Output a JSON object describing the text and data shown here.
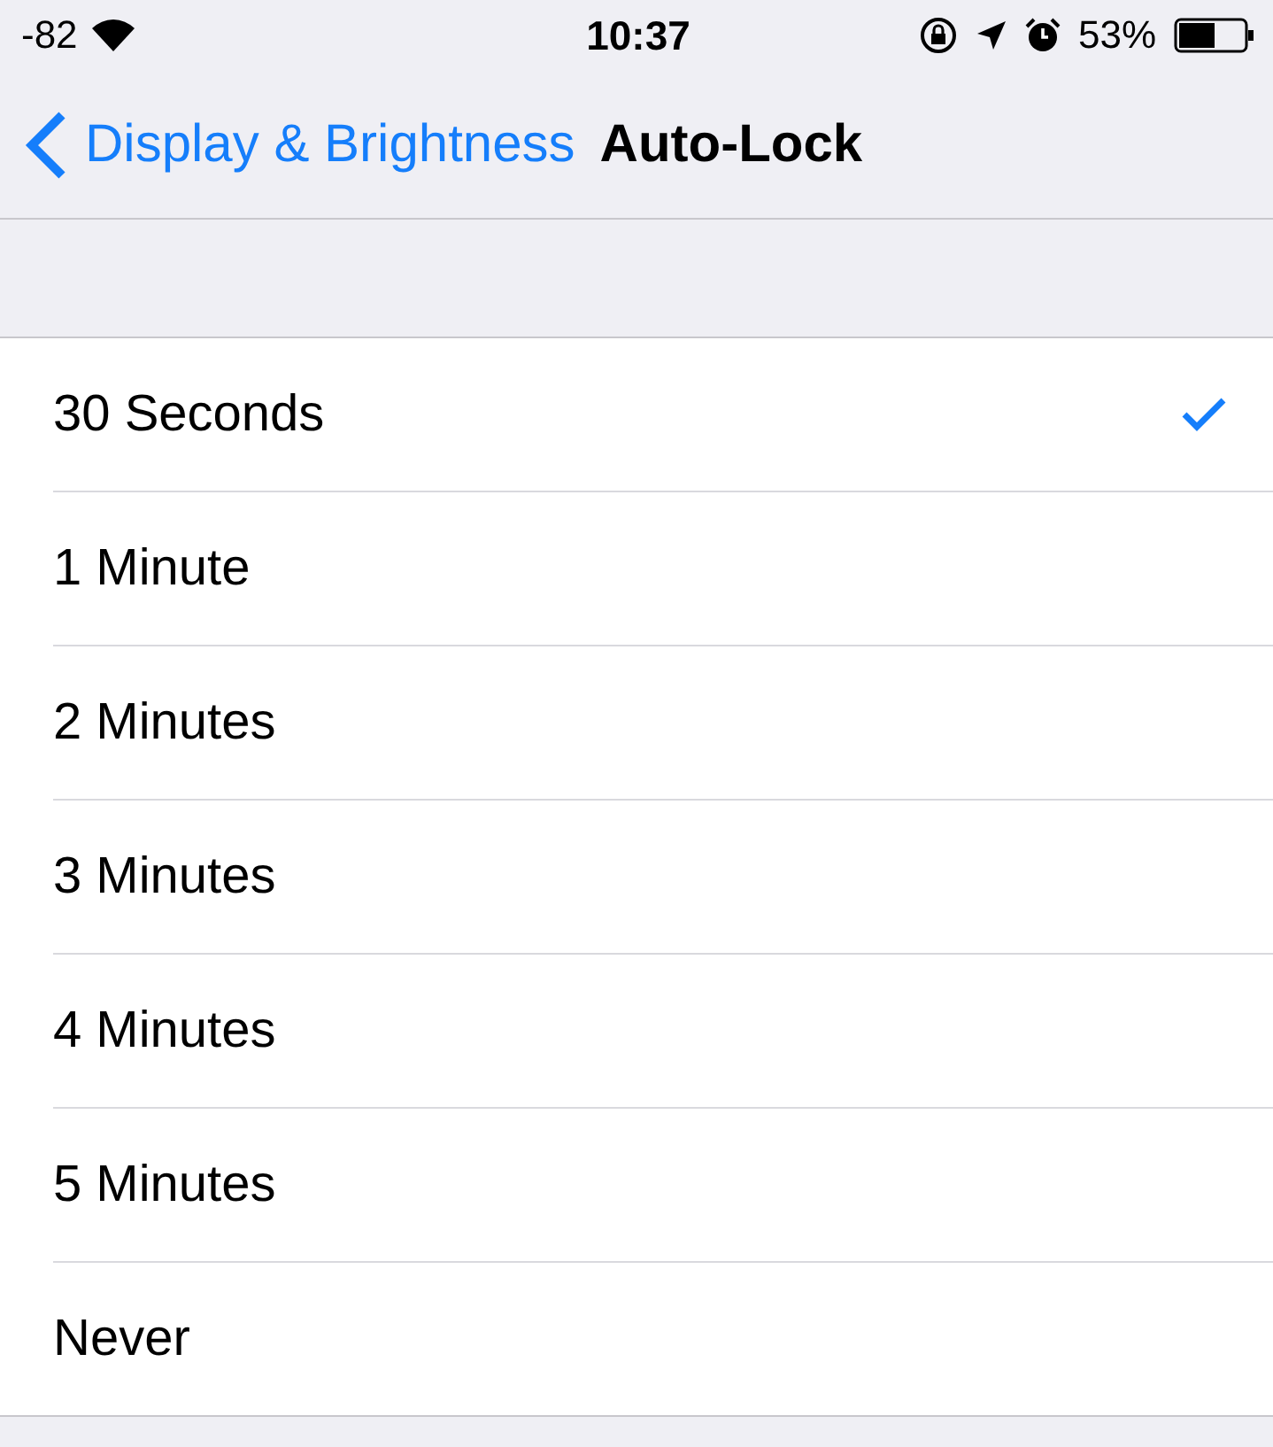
{
  "status_bar": {
    "signal": "-82",
    "time": "10:37",
    "battery": "53%"
  },
  "nav": {
    "back": "Display & Brightness",
    "title": "Auto-Lock"
  },
  "options": [
    {
      "label": "30 Seconds",
      "selected": true
    },
    {
      "label": "1 Minute",
      "selected": false
    },
    {
      "label": "2 Minutes",
      "selected": false
    },
    {
      "label": "3 Minutes",
      "selected": false
    },
    {
      "label": "4 Minutes",
      "selected": false
    },
    {
      "label": "5 Minutes",
      "selected": false
    },
    {
      "label": "Never",
      "selected": false
    }
  ]
}
